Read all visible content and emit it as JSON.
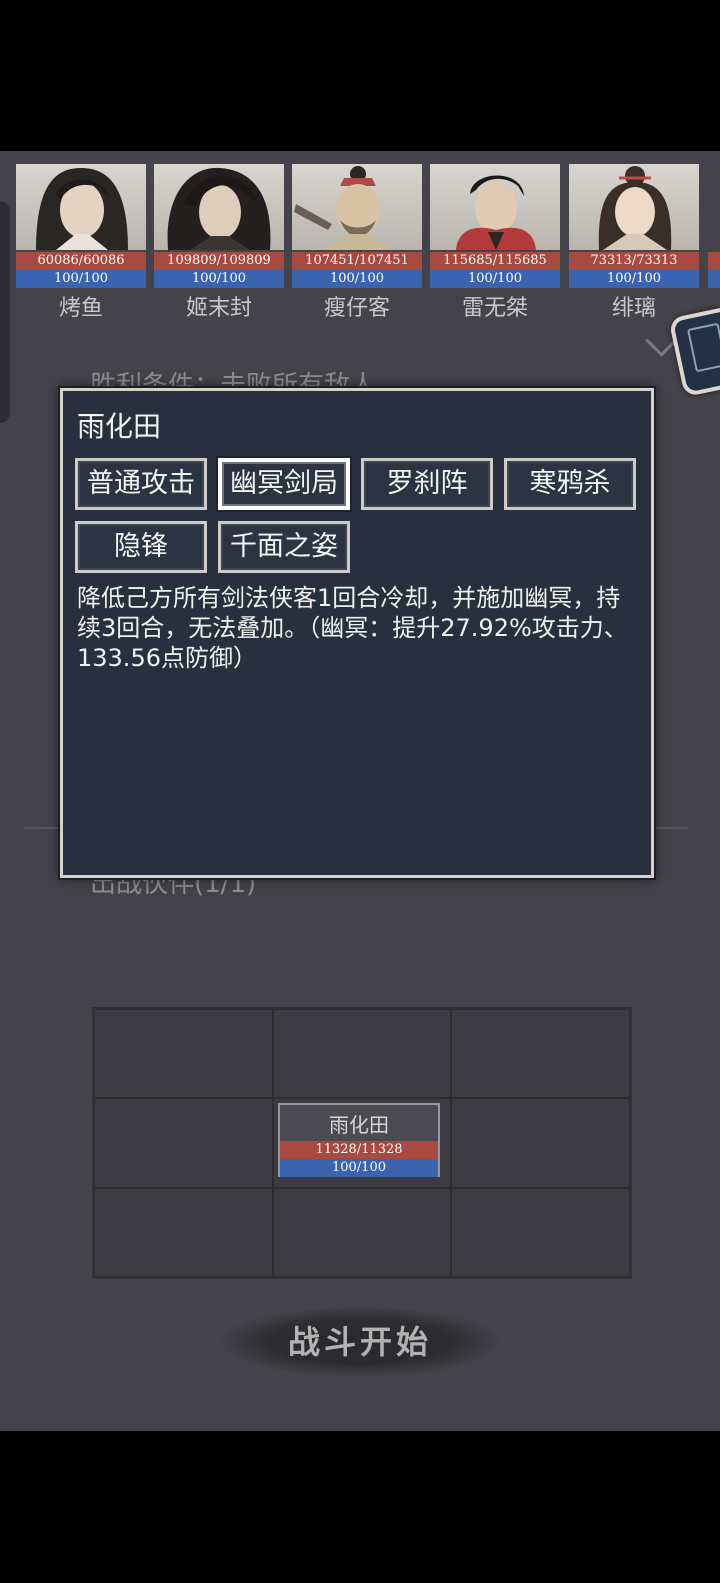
{
  "enemies": [
    {
      "name": "烤鱼",
      "hp": "60086/60086",
      "mp": "100/100"
    },
    {
      "name": "姬末封",
      "hp": "109809/109809",
      "mp": "100/100"
    },
    {
      "name": "瘦仔客",
      "hp": "107451/107451",
      "mp": "100/100"
    },
    {
      "name": "雷无桀",
      "hp": "115685/115685",
      "mp": "100/100"
    },
    {
      "name": "绯璃",
      "hp": "73313/73313",
      "mp": "100/100"
    }
  ],
  "background": {
    "victory_condition": "胜利条件：击败所有敌人",
    "team_label": "出战伙伴(1/1)"
  },
  "formation": {
    "ally": {
      "name": "雨化田",
      "hp": "11328/11328",
      "mp": "100/100"
    }
  },
  "start_button": "战斗开始",
  "skill_popup": {
    "title": "雨化田",
    "skills": [
      "普通攻击",
      "幽冥剑局",
      "罗刹阵",
      "寒鸦杀",
      "隐锋",
      "千面之姿"
    ],
    "selected": "幽冥剑局",
    "description": "降低己方所有剑法侠客1回合冷却，并施加幽冥，持续3回合，无法叠加。（幽冥：提升27.92%攻击力、133.56点防御）"
  },
  "colors": {
    "hp_bar": "#a84a3f",
    "mp_bar": "#3a63b0",
    "popup_bg": "#28303f",
    "game_bg": "#45434a"
  }
}
